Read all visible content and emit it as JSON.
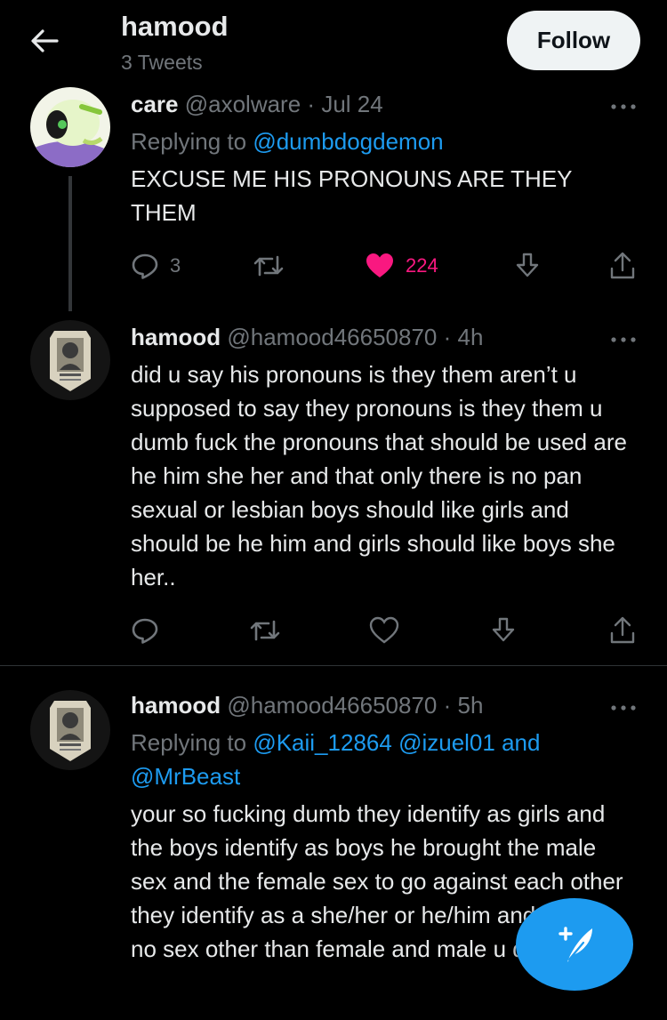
{
  "header": {
    "title": "hamood",
    "subtitle": "3 Tweets",
    "follow_label": "Follow"
  },
  "tweets": [
    {
      "name": "care",
      "handle": "@axolware",
      "separator": "·",
      "time": "Jul 24",
      "replying_prefix": "Replying to",
      "replying_to": [
        "@dumbdogdemon"
      ],
      "text": "EXCUSE ME HIS PRONOUNS ARE THEY THEM",
      "reply_count": "3",
      "like_count": "224",
      "liked": true,
      "avatar_icon": "cartoon-character-avatar"
    },
    {
      "name": "hamood",
      "handle": "@hamood46650870",
      "separator": "·",
      "time": "4h",
      "text": "did u say his pronouns is they them aren’t u supposed to say they pronouns is they them u dumb fuck the pronouns that should be used are he him she her and that only there is no pan sexual or lesbian boys should like girls and should be he him and girls should like boys she her..",
      "avatar_icon": "player-card-avatar"
    },
    {
      "name": "hamood",
      "handle": "@hamood46650870",
      "separator": "·",
      "time": "5h",
      "replying_prefix": "Replying to",
      "replying_to": [
        "@Kaii_12864",
        "@izuel01",
        "and",
        "@MrBeast"
      ],
      "text": "your so fucking dumb they identify as girls and the boys identify as boys he brought the male sex and the female sex to go against each other they identify as a she/her or he/him and there is no sex other than female and male u dumb fuck",
      "avatar_icon": "player-card-avatar"
    }
  ],
  "icons": {
    "back": "arrow-left-icon",
    "more": "more-horizontal-icon",
    "reply": "reply-bubble-icon",
    "retweet": "retweet-icon",
    "like": "heart-icon",
    "bookmark": "bookmark-download-icon",
    "share": "share-icon",
    "compose": "compose-tweet-icon"
  },
  "colors": {
    "background": "#000000",
    "text": "#e7e9ea",
    "muted": "#71767b",
    "accent": "#1d9bf0",
    "like": "#f91880"
  }
}
